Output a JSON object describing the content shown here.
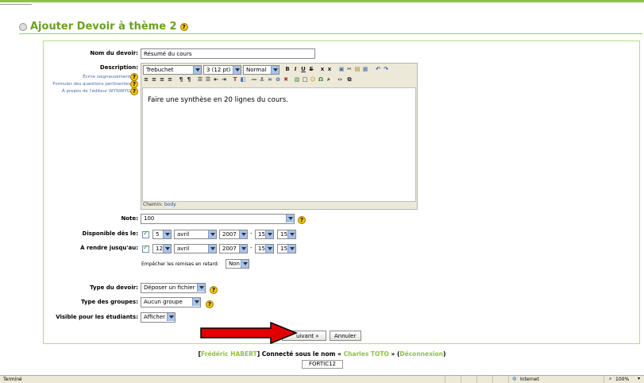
{
  "page": {
    "title": "Ajouter Devoir à thème 2",
    "help_glyph": "?"
  },
  "form": {
    "name_label": "Nom du devoir:",
    "name_value": "Résumé du cours",
    "description_label": "Description:",
    "links": [
      "Écrire soigneusement",
      "Formuler des questions pertinentes",
      "À propos de l'éditeur WYSIWYG"
    ],
    "editor": {
      "font": "Trebuchet",
      "size": "3 (12 pt)",
      "style": "Normal",
      "content": "Faire une synthèse en 20 lignes du cours.",
      "path_label": "Chemin:",
      "path_value": "body"
    },
    "grade_label": "Note:",
    "grade_value": "100",
    "available_label": "Disponible dès le:",
    "available": {
      "day": "5",
      "month": "avril",
      "year": "2007",
      "hour": "15",
      "minute": "15"
    },
    "due_label": "À rendre jusqu'au:",
    "due": {
      "day": "12",
      "month": "avril",
      "year": "2007",
      "hour": "15",
      "minute": "15"
    },
    "prevent_late_label": "Empêcher les remises en retard:",
    "prevent_late_value": "Non",
    "type_label": "Type du devoir:",
    "type_value": "Déposer un fichier",
    "groups_label": "Type des groupes:",
    "groups_value": "Aucun groupe",
    "visible_label": "Visible pour les étudiants:",
    "visible_value": "Afficher",
    "next_button": "Suivant »",
    "next_button_visible": "uivant »",
    "cancel_button": "Annuler"
  },
  "footer": {
    "bracket_open": "[",
    "user_name": "Frédéric HABERT",
    "middle_text": "] Connecté sous le nom «",
    "login_name": "Charles TOTO",
    "after_login": "» (",
    "logout": "Déconnexion",
    "close": ")",
    "course_code": "FORTIC12"
  },
  "statusbar": {
    "left": "Terminé",
    "zone": "Internet",
    "zoom": "100%"
  },
  "colors": {
    "accent_green": "#8fc04a",
    "title_green": "#6aa121",
    "arrow_red": "#e00000"
  }
}
